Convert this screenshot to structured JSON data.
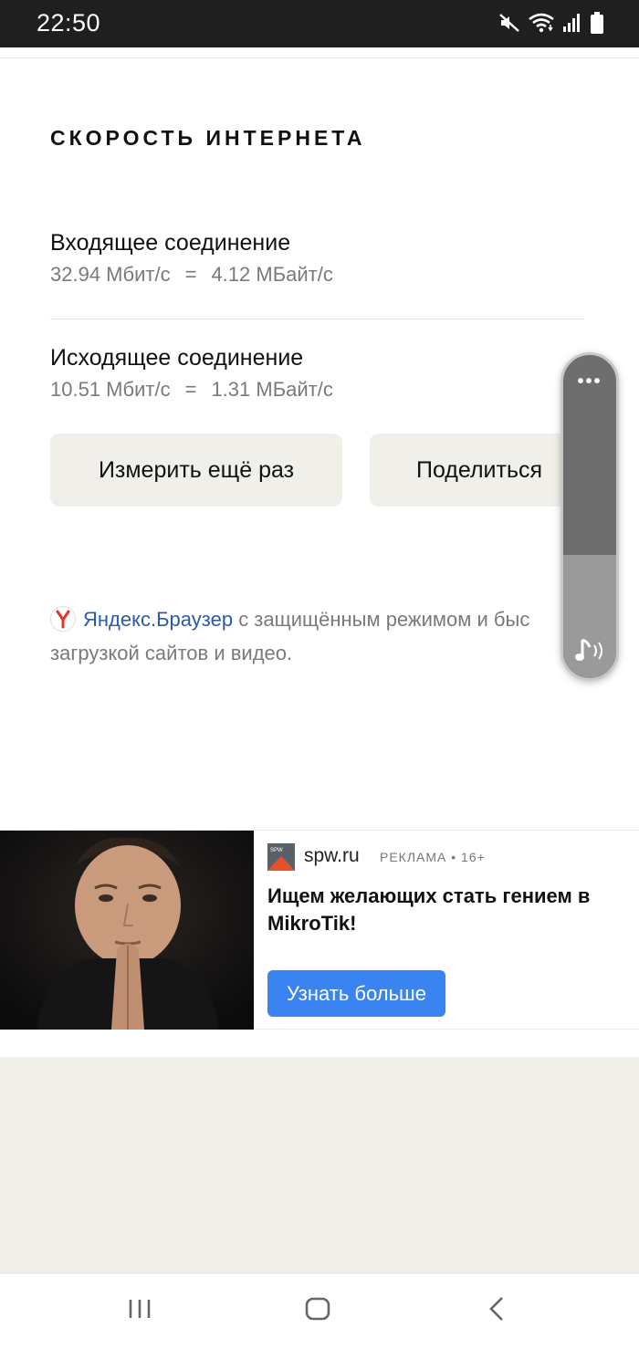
{
  "status_bar": {
    "time": "22:50",
    "icons": [
      "mute-icon",
      "wifi-icon",
      "signal-icon",
      "battery-icon"
    ]
  },
  "speed": {
    "title": "СКОРОСТЬ ИНТЕРНЕТА",
    "incoming": {
      "label": "Входящее соединение",
      "mbit": "32.94 Мбит/с",
      "eq": "=",
      "mbyte": "4.12 МБайт/с"
    },
    "outgoing": {
      "label": "Исходящее соединение",
      "mbit": "10.51 Мбит/с",
      "eq": "=",
      "mbyte": "1.31 МБайт/с"
    },
    "measure_again": "Измерить ещё раз",
    "share": "Поделиться"
  },
  "promo": {
    "link": "Яндекс.Браузер",
    "text_line1": " с защищённым режимом и быс",
    "text_line2": "загрузкой сайтов и видео."
  },
  "volume_overlay": {
    "more": "•••",
    "level": 0.38,
    "icon": "music-note-icon"
  },
  "ad": {
    "domain": "spw.ru",
    "label": "РЕКЛАМА • 16+",
    "headline": "Ищем желающих стать гением в MikroTik!",
    "button": "Узнать больше",
    "logo_text": "SPW"
  },
  "nav": {
    "icons": [
      "recent-apps-icon",
      "home-icon",
      "back-icon"
    ]
  },
  "colors": {
    "accent_blue": "#3a84f2",
    "link_blue": "#2a5aa8",
    "button_bg": "#f1efe9",
    "yandex_red": "#e8322c"
  }
}
